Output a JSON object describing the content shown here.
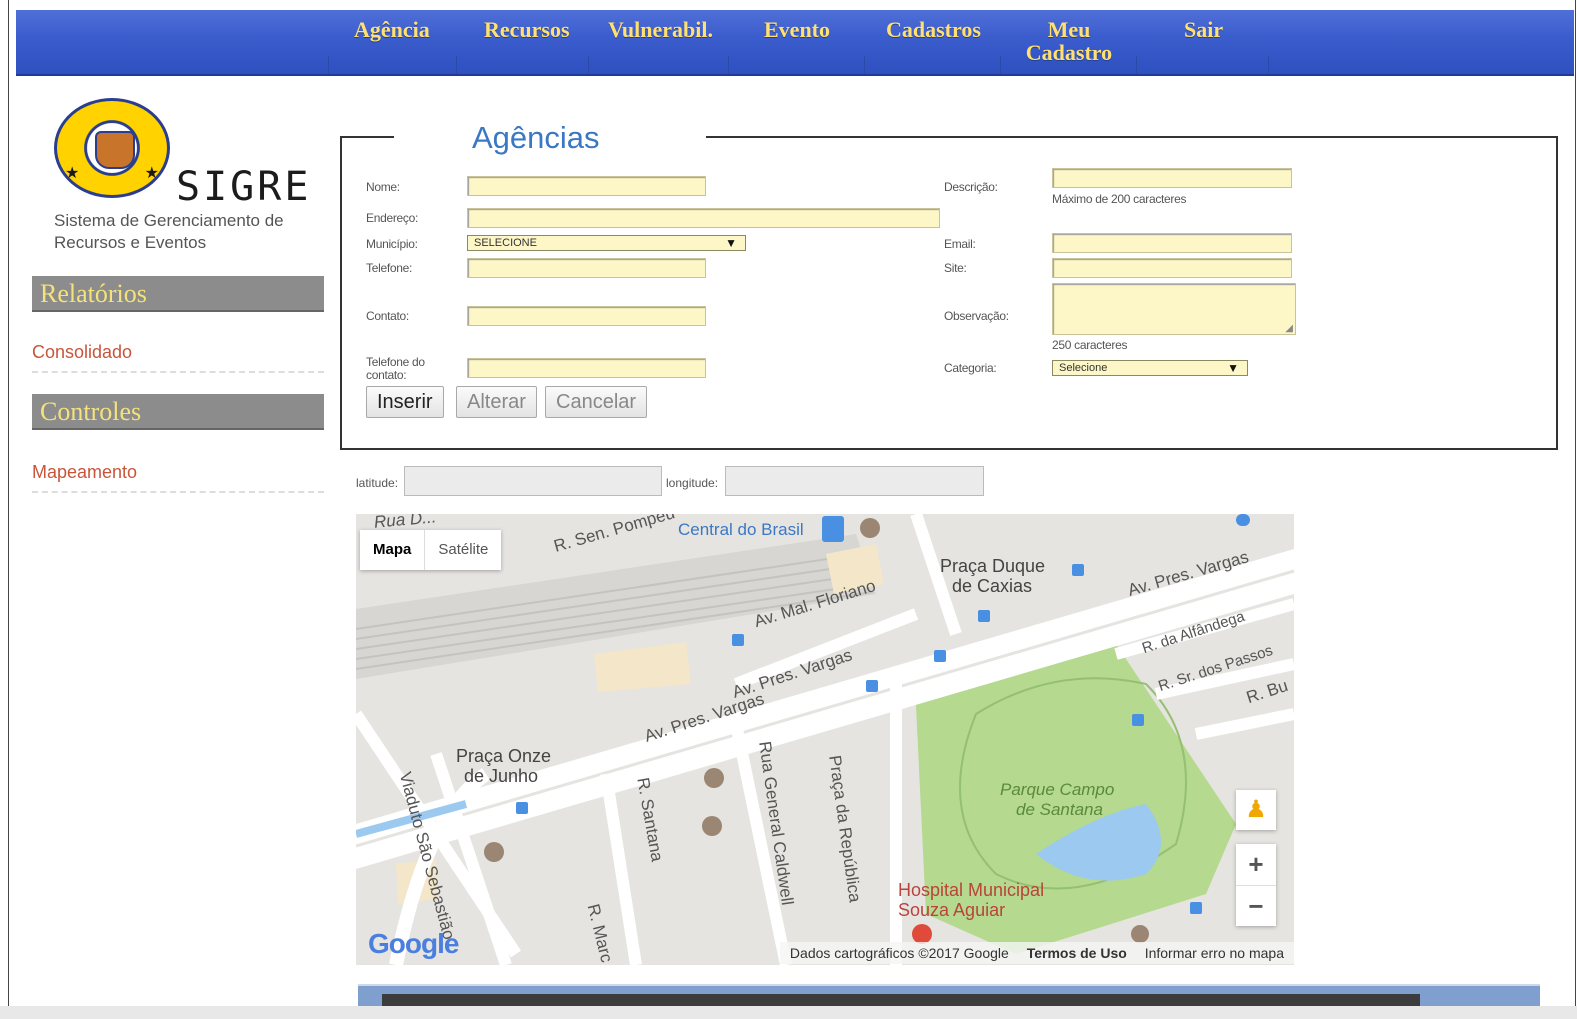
{
  "nav": {
    "items": [
      {
        "label": "Agência"
      },
      {
        "label": "Recursos"
      },
      {
        "label": "Vulnerabil."
      },
      {
        "label": "Evento"
      },
      {
        "label": "Cadastros"
      },
      {
        "label": "Meu Cadastro"
      },
      {
        "label": "Sair"
      }
    ]
  },
  "logo": {
    "title": "SIGRE",
    "subtitle_line1": "Sistema de Gerenciamento de",
    "subtitle_line2": "Recursos e Eventos"
  },
  "sidebar": {
    "reports_heading": "Relatórios",
    "reports_link": "Consolidado",
    "controls_heading": "Controles",
    "controls_link": "Mapeamento"
  },
  "form": {
    "legend": "Agências",
    "labels": {
      "nome": "Nome:",
      "endereco": "Endereço:",
      "municipio": "Município:",
      "telefone": "Telefone:",
      "contato": "Contato:",
      "telefone_contato": "Telefone do contato:",
      "descricao": "Descrição:",
      "email": "Email:",
      "site": "Site:",
      "observacao": "Observação:",
      "categoria": "Categoria:"
    },
    "municipio_value": "SELECIONE",
    "categoria_value": "Selecione",
    "descricao_hint": "Máximo de 200 caracteres",
    "observacao_hint": "250 caracteres",
    "buttons": {
      "insert": "Inserir",
      "alter": "Alterar",
      "cancel": "Cancelar"
    }
  },
  "coords": {
    "latitude_label": "latitude:",
    "longitude_label": "longitude:"
  },
  "map": {
    "type_map": "Mapa",
    "type_satellite": "Satélite",
    "attribution": "Dados cartográficos ©2017 Google",
    "terms": "Termos de Uso",
    "report": "Informar erro no mapa",
    "google": "Google",
    "labels": {
      "rua_top": "Rua D...",
      "sen_pompeu": "R. Sen. Pompeu",
      "central": "Central do Brasil",
      "praca_duque": "Praça Duque",
      "de_caxias": "de Caxias",
      "pres_vargas_ne": "Av. Pres. Vargas",
      "mal_floriano": "Av. Mal. Floriano",
      "alfandega": "R. da Alfândega",
      "sr_passos": "R. Sr. dos Passos",
      "r_bu": "R. Bu",
      "pres_vargas_mid": "Av. Pres. Vargas",
      "pres_vargas_sw": "Av. Pres. Vargas",
      "praca_republica": "Praça da República",
      "praca_onze": "Praça Onze",
      "de_junho": "de Junho",
      "parque1": "Parque Campo",
      "parque2": "de Santana",
      "r_santana": "R. Santana",
      "general_caldwell": "Rua General Caldwell",
      "viaduto": "Viaduto São Sebastião",
      "hospital1": "Hospital Municipal",
      "hospital2": "Souza Aguiar",
      "r_marc": "R. Marc"
    }
  },
  "colors": {
    "nav_bg": "#3a5ccc",
    "nav_text": "#ffe070",
    "input_bg": "#fdf7c8",
    "legend_text": "#3a78c4",
    "link_text": "#c8553a",
    "park": "#b5d98f",
    "water": "#9cc9f0"
  }
}
